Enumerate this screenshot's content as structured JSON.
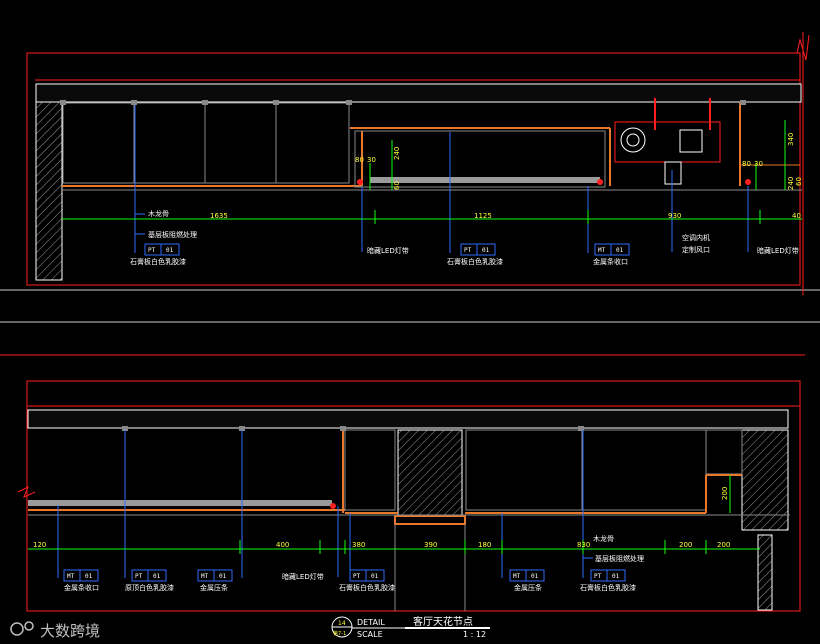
{
  "labels": {
    "wood_keel": "木龙骨",
    "fire_board": "基层板阻燃处理",
    "gypsum_paint": "石膏板白色乳胶漆",
    "hidden_led": "暗藏LED灯带",
    "metal_trim": "金属条收口",
    "ac_internal": "空调内机",
    "custom_vent": "定制风口",
    "paint_top": "原顶白色乳胶漆",
    "metal_strip": "金属压条"
  },
  "tags": {
    "pt": "PT",
    "mt": "MT",
    "num": "01"
  },
  "upper_dims": {
    "d80": "80",
    "d30": "30",
    "d240a": "240",
    "d60a": "60",
    "d1635": "1635",
    "d1125": "1125",
    "d930": "930",
    "d40": "40",
    "d80b": "80",
    "d30b": "30",
    "d340": "340",
    "d60b": "60",
    "d240b": "240"
  },
  "lower_dims": {
    "d120": "120",
    "d400": "400",
    "d380": "380",
    "d390": "390",
    "d180": "180",
    "d830": "830",
    "d200a": "200",
    "d200b": "200",
    "d200c": "200"
  },
  "title_block": {
    "detail_no": "14",
    "detail_ref": "第7-1",
    "detail_label": "DETAIL",
    "title": "客厅天花节点",
    "scale_label": "SCALE",
    "scale_value": "1 : 12"
  },
  "watermark": "大数跨境",
  "colors": {
    "bg": "#000000",
    "frame": "#ff1f1f",
    "white": "#ffffff",
    "green": "#10ff10",
    "blue": "#2f6bff",
    "orange": "#e8782a",
    "gray": "#8a8a8a",
    "yellow": "#ffff33"
  }
}
